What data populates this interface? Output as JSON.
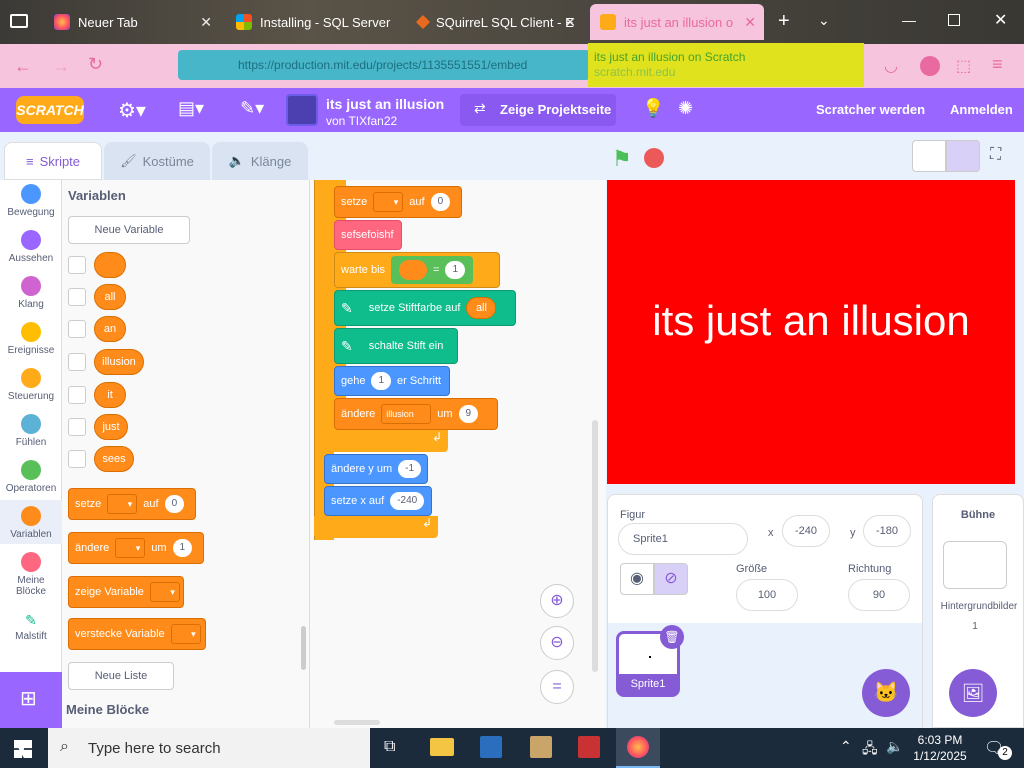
{
  "browser": {
    "tabs": [
      {
        "label": "Neuer Tab"
      },
      {
        "label": "Installing - SQL Server"
      },
      {
        "label": "SQuirreL SQL Client - E"
      },
      {
        "label": "its just an illusion on"
      }
    ],
    "url": "https://production.mit.edu/projects/1135551551/embed",
    "tooltip": {
      "title": "its just an illusion on Scratch",
      "host": "scratch.mit.edu"
    }
  },
  "menu": {
    "logo": "SCRATCH",
    "project_title": "its just an illusion",
    "author": "von TIXfan22",
    "see_project": "Zeige Projektseite",
    "join": "Scratcher werden",
    "signin": "Anmelden"
  },
  "editor_tabs": {
    "code": "Skripte",
    "costumes": "Kostüme",
    "sounds": "Klänge"
  },
  "categories": [
    {
      "label": "Bewegung",
      "color": "#4c97ff"
    },
    {
      "label": "Aussehen",
      "color": "#9966ff"
    },
    {
      "label": "Klang",
      "color": "#cf63cf"
    },
    {
      "label": "Ereignisse",
      "color": "#ffbf00"
    },
    {
      "label": "Steuerung",
      "color": "#ffab19"
    },
    {
      "label": "Fühlen",
      "color": "#5cb1d6"
    },
    {
      "label": "Operatoren",
      "color": "#59c059"
    },
    {
      "label": "Variablen",
      "color": "#ff8c1a"
    },
    {
      "label": "Meine Blöcke",
      "color": "#ff6680"
    },
    {
      "label": "Malstift",
      "color": "#0fbd8c"
    }
  ],
  "palette": {
    "section": "Variablen",
    "new_variable": "Neue Variable",
    "variables": [
      "",
      "all",
      "an",
      "illusion",
      "it",
      "just",
      "sees"
    ],
    "set_label": "setze",
    "to_label": "auf",
    "set_value": "0",
    "change_label": "ändere",
    "by_label": "um",
    "change_value": "1",
    "show_var": "zeige Variable",
    "hide_var": "verstecke Variable",
    "new_list": "Neue Liste",
    "my_blocks": "Meine Blöcke"
  },
  "script": {
    "set_label": "setze",
    "to_label": "auf",
    "set_value": "0",
    "broadcast": "sefsefoishf",
    "wait_until": "warte bis",
    "eq_value": "1",
    "pen_color": "setze Stiftfarbe auf",
    "pen_color_var": "all",
    "pen_down": "schalte Stift ein",
    "move": "gehe",
    "move_value": "1",
    "move_suffix": "er Schritt",
    "change_label": "ändere",
    "change_var": "illusion",
    "change_by": "um",
    "change_value": "9",
    "change_y": "ändere y um",
    "change_y_value": "-1",
    "set_x": "setze x auf",
    "set_x_value": "-240"
  },
  "stage": {
    "text": "its just an illusion"
  },
  "sprite_info": {
    "figure_label": "Figur",
    "name": "Sprite1",
    "x_label": "x",
    "x": "-240",
    "y_label": "y",
    "y": "-180",
    "size_label": "Größe",
    "size": "100",
    "direction_label": "Richtung",
    "direction": "90",
    "thumb_label": "Sprite1"
  },
  "stage_panel": {
    "title": "Bühne",
    "backdrops_label": "Hintergrundbilder",
    "backdrops_count": "1"
  },
  "taskbar": {
    "search": "Type here to search",
    "time": "6:03 PM",
    "date": "1/12/2025",
    "notif": "2"
  }
}
